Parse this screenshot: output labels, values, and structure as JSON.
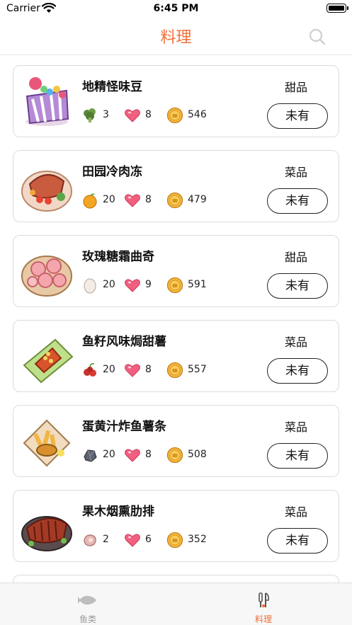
{
  "status_bar": {
    "carrier": "Carrier",
    "time": "6:45 PM"
  },
  "header": {
    "title": "料理",
    "search_icon": "search-icon",
    "title_color": "#f0703a"
  },
  "recipes": [
    {
      "name": "地精怪味豆",
      "category": "甜品",
      "ingredient_icon": "broccoli-icon",
      "ingredient_count": "3",
      "heart_count": "8",
      "coin_count": "546",
      "status": "未有",
      "thumb": "gift-basket"
    },
    {
      "name": "田园冷肉冻",
      "category": "菜品",
      "ingredient_icon": "orange-icon",
      "ingredient_count": "20",
      "heart_count": "8",
      "coin_count": "479",
      "status": "未有",
      "thumb": "meat-platter"
    },
    {
      "name": "玫瑰糖霜曲奇",
      "category": "甜品",
      "ingredient_icon": "egg-icon",
      "ingredient_count": "20",
      "heart_count": "9",
      "coin_count": "591",
      "status": "未有",
      "thumb": "rose-cookies"
    },
    {
      "name": "鱼籽风味焗甜薯",
      "category": "菜品",
      "ingredient_icon": "berries-icon",
      "ingredient_count": "20",
      "heart_count": "8",
      "coin_count": "557",
      "status": "未有",
      "thumb": "baked-sweet-potato"
    },
    {
      "name": "蛋黄汁炸鱼薯条",
      "category": "菜品",
      "ingredient_icon": "ore-icon",
      "ingredient_count": "20",
      "heart_count": "8",
      "coin_count": "508",
      "status": "未有",
      "thumb": "fish-and-chips"
    },
    {
      "name": "果木烟熏肋排",
      "category": "菜品",
      "ingredient_icon": "meat-icon",
      "ingredient_count": "2",
      "heart_count": "6",
      "coin_count": "352",
      "status": "未有",
      "thumb": "smoked-ribs"
    }
  ],
  "tab_bar": {
    "tabs": [
      {
        "label": "鱼类",
        "icon": "fish-icon",
        "active": false
      },
      {
        "label": "料理",
        "icon": "cooking-icon",
        "active": true
      }
    ],
    "active_color": "#f0703a",
    "inactive_color": "#9a9a9a"
  }
}
